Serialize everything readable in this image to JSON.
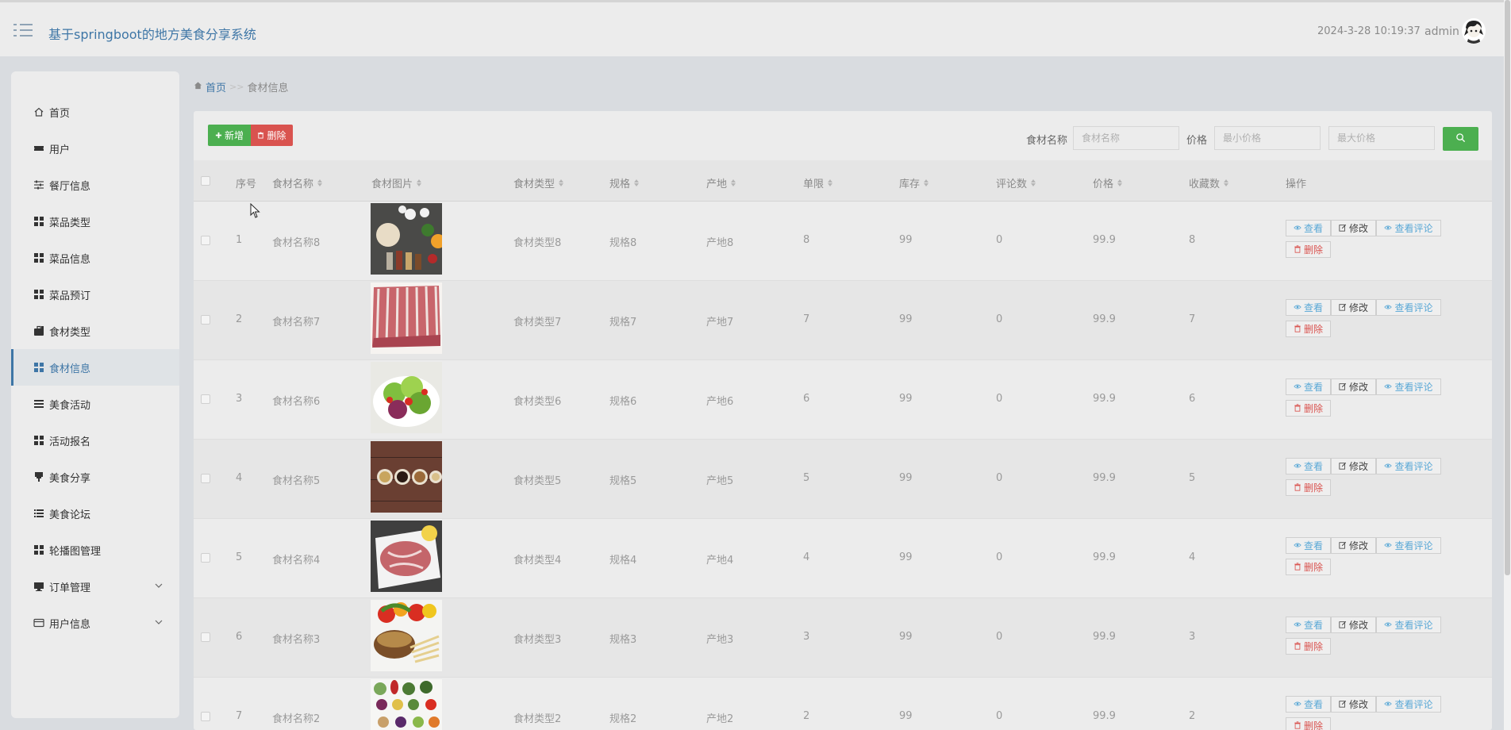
{
  "header": {
    "title": "基于springboot的地方美食分享系统",
    "datetime": "2024-3-28 10:19:37",
    "username": "admin"
  },
  "sidebar": {
    "items": [
      {
        "label": "首页",
        "icon": "home-icon"
      },
      {
        "label": "用户",
        "icon": "ticket-icon"
      },
      {
        "label": "餐厅信息",
        "icon": "sliders-icon"
      },
      {
        "label": "菜品类型",
        "icon": "grid-icon"
      },
      {
        "label": "菜品信息",
        "icon": "grid-icon"
      },
      {
        "label": "菜品预订",
        "icon": "grid-icon"
      },
      {
        "label": "食材类型",
        "icon": "briefcase-icon"
      },
      {
        "label": "食材信息",
        "icon": "grid-icon",
        "active": true
      },
      {
        "label": "美食活动",
        "icon": "list-icon"
      },
      {
        "label": "活动报名",
        "icon": "grid-icon"
      },
      {
        "label": "美食分享",
        "icon": "pin-icon"
      },
      {
        "label": "美食论坛",
        "icon": "list-icon"
      },
      {
        "label": "轮播图管理",
        "icon": "grid-icon"
      },
      {
        "label": "订单管理",
        "icon": "monitor-icon",
        "expandable": true
      },
      {
        "label": "用户信息",
        "icon": "card-icon",
        "expandable": true
      }
    ]
  },
  "breadcrumb": {
    "home": "首页",
    "separator": ">>",
    "current": "食材信息"
  },
  "toolbar": {
    "add_label": "新增",
    "delete_label": "删除",
    "name_label": "食材名称",
    "name_placeholder": "食材名称",
    "price_label": "价格",
    "min_placeholder": "最小价格",
    "max_placeholder": "最大价格"
  },
  "table": {
    "headers": [
      "序号",
      "食材名称",
      "食材图片",
      "食材类型",
      "规格",
      "产地",
      "单限",
      "库存",
      "评论数",
      "价格",
      "收藏数",
      "操作"
    ],
    "actions": {
      "view": "查看",
      "edit": "修改",
      "reviews": "查看评论",
      "delete": "删除"
    },
    "rows": [
      {
        "no": "1",
        "name": "食材名称8",
        "image": "spices",
        "type": "食材类型8",
        "spec": "规格8",
        "origin": "产地8",
        "limit": "8",
        "stock": "99",
        "comments": "0",
        "price": "99.9",
        "favorites": "8"
      },
      {
        "no": "2",
        "name": "食材名称7",
        "image": "meat-ribs",
        "type": "食材类型7",
        "spec": "规格7",
        "origin": "产地7",
        "limit": "7",
        "stock": "99",
        "comments": "0",
        "price": "99.9",
        "favorites": "7"
      },
      {
        "no": "3",
        "name": "食材名称6",
        "image": "salad",
        "type": "食材类型6",
        "spec": "规格6",
        "origin": "产地6",
        "limit": "6",
        "stock": "99",
        "comments": "0",
        "price": "99.9",
        "favorites": "6"
      },
      {
        "no": "4",
        "name": "食材名称5",
        "image": "grains",
        "type": "食材类型5",
        "spec": "规格5",
        "origin": "产地5",
        "limit": "5",
        "stock": "99",
        "comments": "0",
        "price": "99.9",
        "favorites": "5"
      },
      {
        "no": "5",
        "name": "食材名称4",
        "image": "steak",
        "type": "食材类型4",
        "spec": "规格4",
        "origin": "产地4",
        "limit": "4",
        "stock": "99",
        "comments": "0",
        "price": "99.9",
        "favorites": "4"
      },
      {
        "no": "6",
        "name": "食材名称3",
        "image": "vegetable-basket",
        "type": "食材类型3",
        "spec": "规格3",
        "origin": "产地3",
        "limit": "3",
        "stock": "99",
        "comments": "0",
        "price": "99.9",
        "favorites": "3"
      },
      {
        "no": "7",
        "name": "食材名称2",
        "image": "vegetables",
        "type": "食材类型2",
        "spec": "规格2",
        "origin": "产地2",
        "limit": "2",
        "stock": "99",
        "comments": "0",
        "price": "99.9",
        "favorites": "2"
      }
    ]
  },
  "colors": {
    "accent": "#3e76a6",
    "success": "#4caf50",
    "danger": "#d9534f",
    "info": "#5aa8d6"
  }
}
